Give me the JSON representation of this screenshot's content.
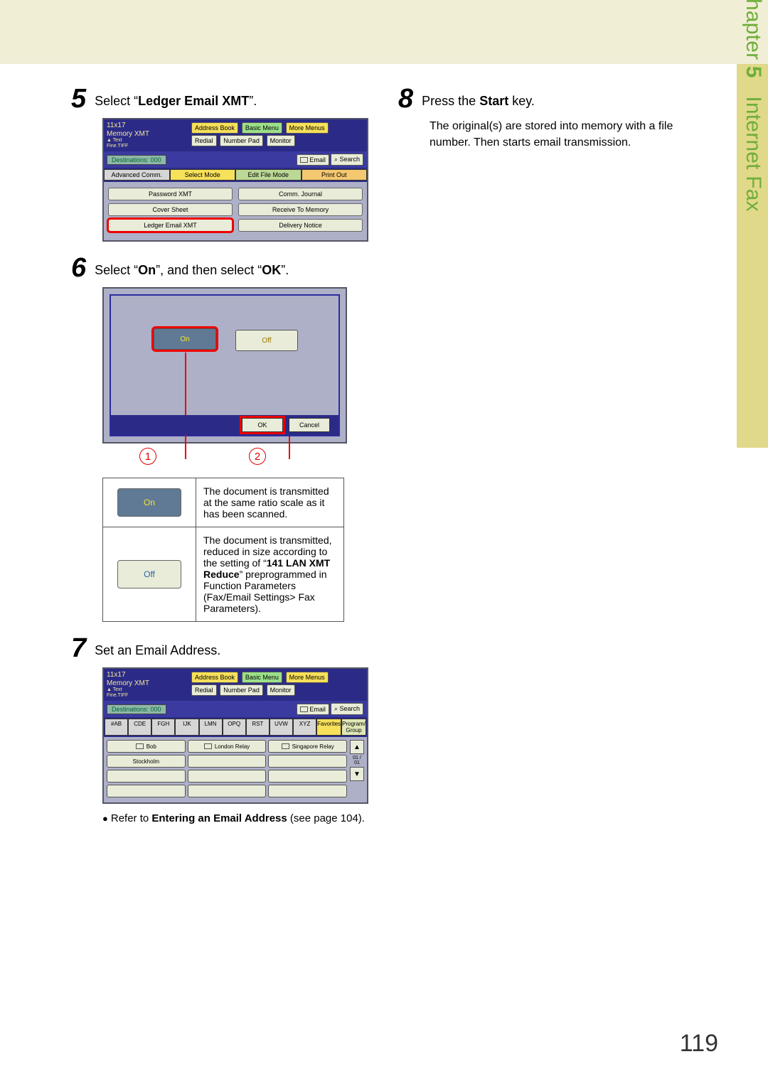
{
  "page_number": "119",
  "side": {
    "chapter": "Chapter",
    "num": "5",
    "title": "Internet Fax"
  },
  "steps": [
    {
      "num": "5",
      "pre": "Select ",
      "bold": "Ledger Email XMT",
      "post": "."
    },
    {
      "num": "6",
      "p0": "Select ",
      "b0": "On",
      "p1": ", and then select ",
      "b1": "OK",
      "p2": "."
    },
    {
      "num": "7",
      "text": "Set an Email Address.",
      "ref_pre": "Refer to ",
      "ref_bold": "Entering an Email Address",
      "ref_post": " (see page 104)."
    },
    {
      "num": "8",
      "pre": "Press the ",
      "bold": "Start",
      "post": " key.",
      "body": "The original(s) are stored into memory with a file number. Then starts email transmission."
    }
  ],
  "s1": {
    "size": "11x17",
    "mem": "Memory XMT",
    "text": "▲ Text",
    "fine": "Fine.TIFF",
    "r1": [
      "Address Book",
      "Basic Menu",
      "More Menus"
    ],
    "r2": [
      "Redial",
      "Number Pad",
      "Monitor"
    ],
    "dest": "Destinations: 000",
    "email": "Email",
    "search": "⌕ Search",
    "tabs": [
      "Advanced Comm.",
      "Select Mode",
      "Edit File Mode",
      "Print Out"
    ],
    "b": [
      "Password XMT",
      "Comm. Journal",
      "Cover Sheet",
      "Receive To Memory",
      "Ledger Email XMT",
      "Delivery Notice"
    ]
  },
  "s2": {
    "on": "On",
    "off": "Off",
    "ok": "OK",
    "cancel": "Cancel",
    "c1": "1",
    "c2": "2"
  },
  "tbl": {
    "on_label": "On",
    "on_desc": "The document is transmitted at the same ratio scale as it has been scanned.",
    "off_label": "Off",
    "off_pre": "The document is transmitted, reduced in size according to the setting of ",
    "off_bold": "141 LAN XMT Reduce",
    "off_post": " preprogrammed in Function Parameters (Fax/Email Settings> Fax Parameters)."
  },
  "s3": {
    "t": [
      "#AB",
      "CDE",
      "FGH",
      "IJK",
      "LMN",
      "OPQ",
      "RST",
      "UVW",
      "XYZ",
      "Favorites",
      "Program/\nGroup"
    ],
    "e": [
      "Bob",
      "London Relay",
      "Singapore Relay",
      "Stockholm"
    ],
    "pg": "01\n/\n01"
  }
}
